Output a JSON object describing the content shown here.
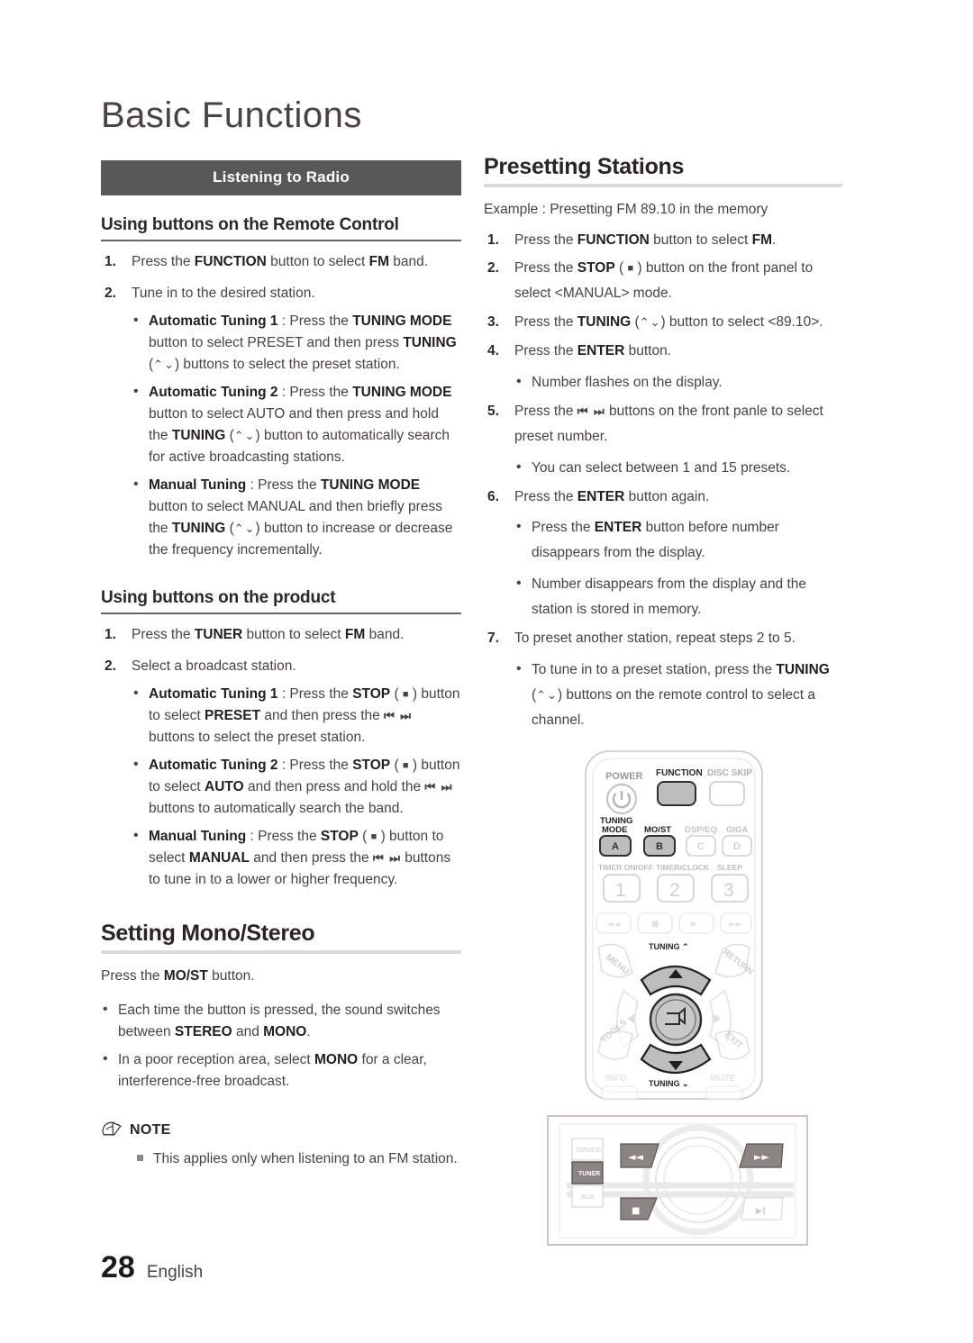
{
  "page": {
    "title": "Basic Functions",
    "number": "28",
    "language": "English"
  },
  "left": {
    "banner": "Listening to Radio",
    "remote_heading": "Using buttons on the Remote Control",
    "remote_steps": [
      {
        "num": "1.",
        "text_html": "Press the <b>FUNCTION</b> button to select <b>FM</b> band."
      },
      {
        "num": "2.",
        "text_html": "Tune in to the desired station.",
        "bullets": [
          "<b>Automatic Tuning 1</b> : Press the <b>TUNING MODE</b> button to select PRESET and then press <b>TUNING</b> (<span class=\"chev\">⌃⌄</span>) buttons to select the preset station.",
          "<b>Automatic Tuning 2</b> : Press the <b>TUNING MODE</b> button to select AUTO and then press and hold the <b>TUNING</b> (<span class=\"chev\">⌃⌄</span>) button to automatically search for active broadcasting stations.",
          "<b>Manual Tuning</b> : Press the <b>TUNING MODE</b> button to select MANUAL and then briefly press the <b>TUNING</b> (<span class=\"chev\">⌃⌄</span>) button to increase or decrease the frequency incrementally."
        ]
      }
    ],
    "product_heading": "Using buttons on the product",
    "product_steps": [
      {
        "num": "1.",
        "text_html": "Press the <b>TUNER</b> button to select <b>FM</b> band."
      },
      {
        "num": "2.",
        "text_html": "Select a broadcast station.",
        "bullets": [
          "<b>Automatic Tuning 1</b> : Press the <b>STOP</b> ( <span class=\"sq\">■</span> ) button to select <b>PRESET</b> and then press the <span class=\"skip\">⏮ ⏭</span> buttons to select the preset station.",
          "<b>Automatic Tuning 2</b> : Press the <b>STOP</b> ( <span class=\"sq\">■</span> ) button to select <b>AUTO</b> and then press and hold the <span class=\"skip\">⏮ ⏭</span> buttons to automatically search the band.",
          "<b>Manual Tuning</b> : Press the <b>STOP</b> ( <span class=\"sq\">■</span> ) button to select <b>MANUAL</b> and then press the <span class=\"skip\">⏮ ⏭</span> buttons to tune in to a lower or higher frequency."
        ]
      }
    ],
    "mono_heading": "Setting Mono/Stereo",
    "mono_intro_html": "Press the <b>MO/ST</b> button.",
    "mono_bullets": [
      "Each time the button is pressed, the sound switches between <b>STEREO</b> and <b>MONO</b>.",
      "In a poor reception area, select <b>MONO</b> for a clear, interference-free broadcast."
    ],
    "note_title": "NOTE",
    "note_items": [
      "This applies only when listening to an FM station."
    ]
  },
  "right": {
    "heading": "Presetting Stations",
    "example": "Example : Presetting FM 89.10 in the memory",
    "steps": [
      {
        "num": "1.",
        "text_html": "Press the <b>FUNCTION</b> button to select <b>FM</b>."
      },
      {
        "num": "2.",
        "text_html": "Press the <b>STOP</b> ( <span class=\"sq\">■</span> ) button on the front panel to select &lt;MANUAL&gt; mode."
      },
      {
        "num": "3.",
        "text_html": "Press the <b>TUNING</b> (<span class=\"chev\">⌃⌄</span>) button to select &lt;89.10&gt;."
      },
      {
        "num": "4.",
        "text_html": "Press the <b>ENTER</b> button.",
        "bullets": [
          "Number flashes on the display."
        ]
      },
      {
        "num": "5.",
        "text_html": "Press the <span class=\"skip\">⏮ ⏭</span> buttons on the front panle to select preset number.",
        "bullets": [
          "You can select between 1 and 15 presets."
        ]
      },
      {
        "num": "6.",
        "text_html": "Press the <b>ENTER</b> button again.",
        "bullets": [
          "Press the <b>ENTER</b> button before number disappears from the display.",
          "Number disappears from the display and the station is stored in memory."
        ]
      },
      {
        "num": "7.",
        "text_html": "To preset another station, repeat steps 2 to 5.",
        "bullets": [
          "To tune in to a preset station, press the <b>TUNING</b> (<span class=\"chev\">⌃⌄</span>) buttons on the remote control to select a channel."
        ]
      }
    ]
  },
  "remote_illustration": {
    "labels": {
      "power": "POWER",
      "function": "FUNCTION",
      "disc_skip": "DISC SKIP",
      "tuning_mode": "TUNING\nMODE",
      "mo_st": "MO/ST",
      "dsp_eq": "DSP/EQ",
      "giga": "GIGA",
      "a": "A",
      "b": "B",
      "c": "C",
      "d": "D",
      "timer_on_off": "TIMER ON/OFF",
      "timer_clock": "TIMER/CLOCK",
      "sleep": "SLEEP",
      "one": "1",
      "two": "2",
      "three": "3",
      "menu": "MENU",
      "return": "RETURN",
      "tools": "TOOLS",
      "exit": "EXIT",
      "tuning_up": "TUNING ⌃",
      "tuning_down": "TUNING ⌄",
      "info": "INFO",
      "mute": "MUTE"
    },
    "highlight_color": "#b9b9b9",
    "outline_color": "#8f8f8f",
    "faded_color": "#d8d8d8"
  },
  "panel_illustration": {
    "labels": {
      "dvd_cd": "DVD/CD",
      "tuner": "TUNER",
      "aux": "AUX",
      "play_pause": "▶‖"
    },
    "highlight_color": "#8c8482"
  }
}
